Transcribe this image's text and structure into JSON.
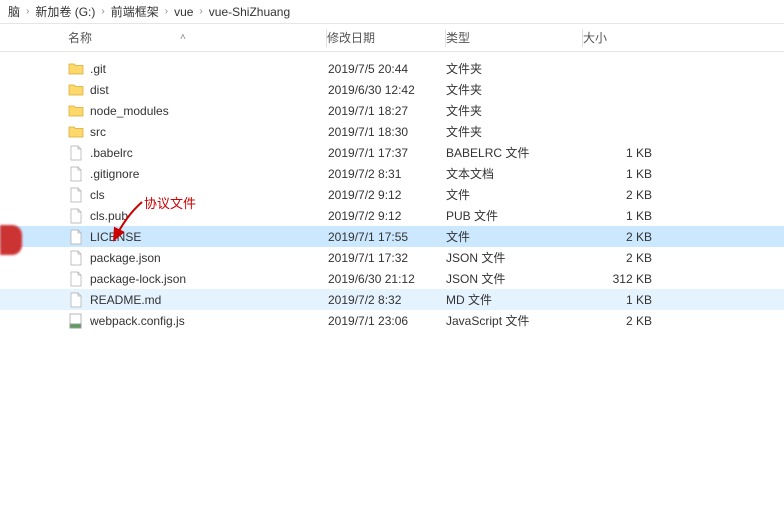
{
  "breadcrumb": {
    "parts": [
      "脑",
      "新加卷 (G:)",
      "前端框架",
      "vue",
      "vue-ShiZhuang"
    ]
  },
  "headers": {
    "name": "名称",
    "date": "修改日期",
    "type": "类型",
    "size": "大小"
  },
  "files": [
    {
      "icon": "folder",
      "name": ".git",
      "date": "2019/7/5 20:44",
      "type": "文件夹",
      "size": ""
    },
    {
      "icon": "folder",
      "name": "dist",
      "date": "2019/6/30 12:42",
      "type": "文件夹",
      "size": ""
    },
    {
      "icon": "folder",
      "name": "node_modules",
      "date": "2019/7/1 18:27",
      "type": "文件夹",
      "size": ""
    },
    {
      "icon": "folder",
      "name": "src",
      "date": "2019/7/1 18:30",
      "type": "文件夹",
      "size": ""
    },
    {
      "icon": "file",
      "name": ".babelrc",
      "date": "2019/7/1 17:37",
      "type": "BABELRC 文件",
      "size": "1 KB"
    },
    {
      "icon": "file",
      "name": ".gitignore",
      "date": "2019/7/2 8:31",
      "type": "文本文档",
      "size": "1 KB"
    },
    {
      "icon": "file",
      "name": "cls",
      "date": "2019/7/2 9:12",
      "type": "文件",
      "size": "2 KB"
    },
    {
      "icon": "file",
      "name": "cls.pub",
      "date": "2019/7/2 9:12",
      "type": "PUB 文件",
      "size": "1 KB"
    },
    {
      "icon": "file",
      "name": "LICENSE",
      "date": "2019/7/1 17:55",
      "type": "文件",
      "size": "2 KB",
      "selected": true
    },
    {
      "icon": "file",
      "name": "package.json",
      "date": "2019/7/1 17:32",
      "type": "JSON 文件",
      "size": "2 KB"
    },
    {
      "icon": "file",
      "name": "package-lock.json",
      "date": "2019/6/30 21:12",
      "type": "JSON 文件",
      "size": "312 KB"
    },
    {
      "icon": "file",
      "name": "README.md",
      "date": "2019/7/2 8:32",
      "type": "MD 文件",
      "size": "1 KB",
      "faint": true
    },
    {
      "icon": "js",
      "name": "webpack.config.js",
      "date": "2019/7/1 23:06",
      "type": "JavaScript 文件",
      "size": "2 KB"
    }
  ],
  "annotation": {
    "label": "协议文件"
  }
}
